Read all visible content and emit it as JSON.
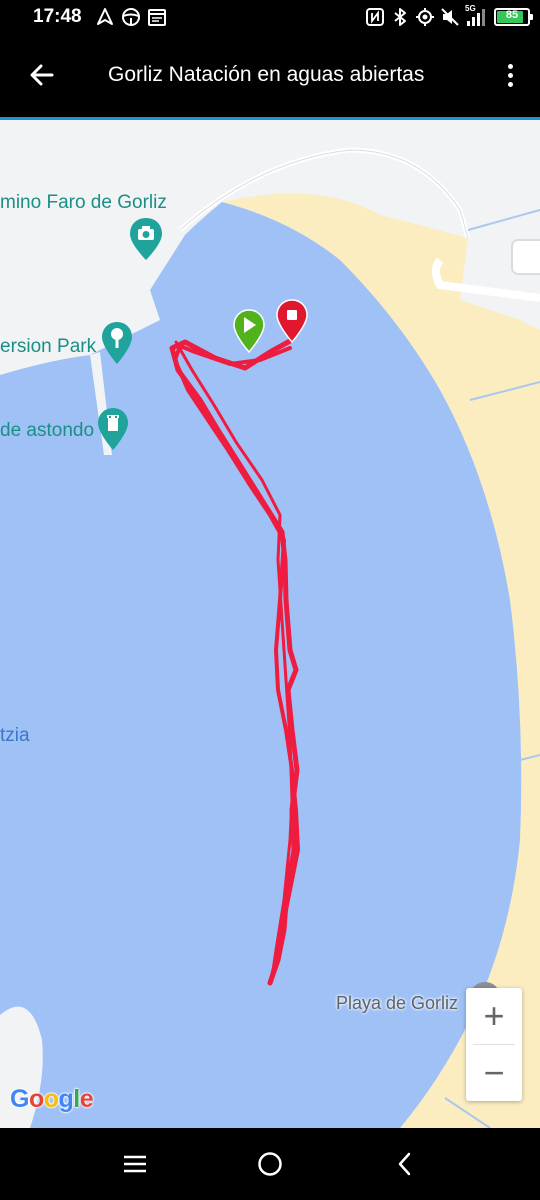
{
  "status_bar": {
    "time": "17:48",
    "network": "5G",
    "battery": "85",
    "battery_level": 0.85
  },
  "app_bar": {
    "title": "Gorliz Natación en aguas abiertas"
  },
  "map": {
    "labels": {
      "faro": "mino Faro de Gorliz",
      "park": "ersion Park",
      "astondo": "de astondo",
      "water": "tzia",
      "beach": "Playa de Gorliz"
    },
    "zoom_in": "+",
    "zoom_out": "−",
    "google_logo": [
      "G",
      "o",
      "o",
      "g",
      "l",
      "e"
    ],
    "colors": {
      "water": "#9fc1f6",
      "land": "#f1f3f4",
      "beach": "#fbedc0",
      "track": "#ee1c3e",
      "start_marker": "#52b21c",
      "stop_marker": "#e0172d",
      "poi": "#1fa39a"
    }
  },
  "icons": {
    "status_left": [
      "navigation-arrow-icon",
      "steering-wheel-icon",
      "calendar-icon"
    ],
    "status_right": [
      "nfc-icon",
      "bluetooth-icon",
      "location-target-icon",
      "mute-icon",
      "signal-icon"
    ]
  },
  "nav_bar": {}
}
